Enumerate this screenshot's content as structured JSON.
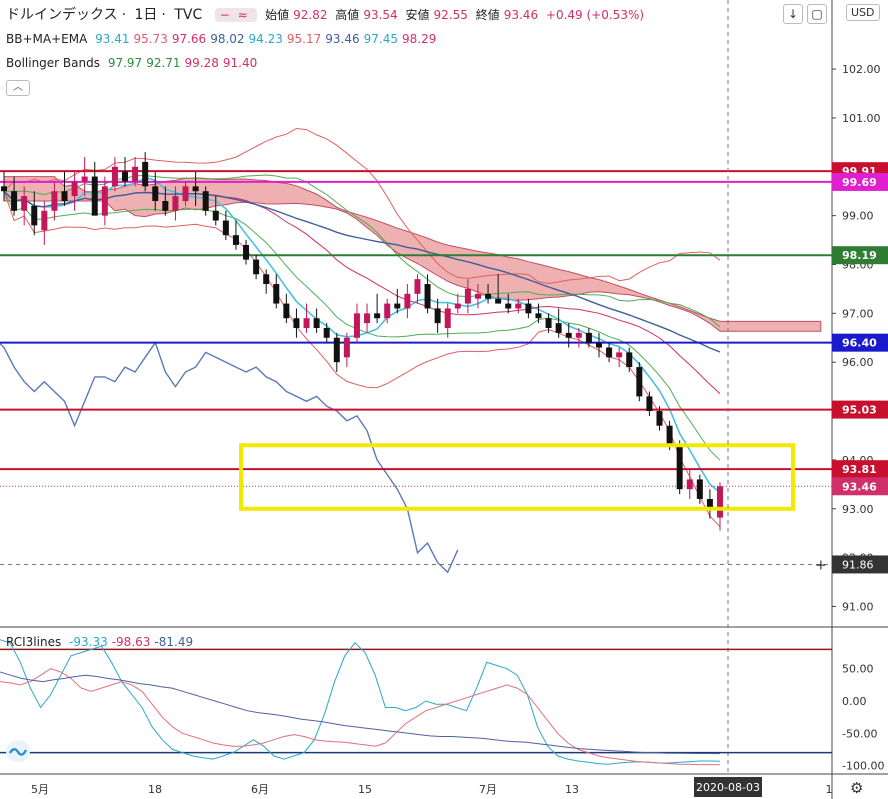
{
  "header": {
    "symbol": "ドルインデックス",
    "interval": "1日",
    "source": "TVC",
    "open_label": "始値",
    "open": "92.82",
    "high_label": "高値",
    "high": "93.54",
    "low_label": "安値",
    "low": "92.55",
    "close_label": "終値",
    "close": "93.46",
    "change": "+0.49 (+0.53%)",
    "currency": "USD",
    "sep": "·",
    "pill_minus": "−",
    "pill_wave": "≈"
  },
  "toolbar": {
    "down_icon": "↓",
    "fullscreen_icon": "▢",
    "collapse_icon": "︿",
    "settings_icon": "⚙"
  },
  "indicators": {
    "bbmaema": {
      "name": "BB+MA+EMA",
      "values": [
        {
          "v": "93.41",
          "color": "#29a8c9"
        },
        {
          "v": "95.73",
          "color": "#e05a6a"
        },
        {
          "v": "97.66",
          "color": "#d0306a"
        },
        {
          "v": "98.02",
          "color": "#3f5f9a"
        },
        {
          "v": "94.23",
          "color": "#29a8c9"
        },
        {
          "v": "95.17",
          "color": "#e05a6a"
        },
        {
          "v": "93.46",
          "color": "#3f5f9a"
        },
        {
          "v": "97.45",
          "color": "#29a8c9"
        },
        {
          "v": "98.29",
          "color": "#d0306a"
        }
      ]
    },
    "bollinger": {
      "name": "Bollinger Bands",
      "values": [
        {
          "v": "97.97",
          "color": "#2e8b3a"
        },
        {
          "v": "92.71",
          "color": "#2e8b3a"
        },
        {
          "v": "99.28",
          "color": "#d0306a"
        },
        {
          "v": "91.40",
          "color": "#d0306a"
        }
      ]
    },
    "rci": {
      "name": "RCI3lines",
      "values": [
        {
          "v": "-93.33",
          "color": "#29a8c9"
        },
        {
          "v": "-98.63",
          "color": "#d0306a"
        },
        {
          "v": "-81.49",
          "color": "#3f5f9a"
        }
      ]
    }
  },
  "chart_data": [
    {
      "type": "candlestick",
      "ylim": [
        90.6,
        102.8
      ],
      "y_ticks": [
        "91.00",
        "92.00",
        "93.00",
        "94.00",
        "95.00",
        "96.00",
        "97.00",
        "98.00",
        "99.00",
        "100.00",
        "101.00",
        "102.00"
      ],
      "x_ticks": [
        "5月",
        "18",
        "6月",
        "15",
        "7月",
        "13",
        "1"
      ],
      "crosshair_date": "2020-08-03",
      "crosshair_price": "91.86",
      "candles": [
        {
          "o": 99.6,
          "h": 99.9,
          "l": 99.3,
          "c": 99.5
        },
        {
          "o": 99.5,
          "h": 99.8,
          "l": 99.0,
          "c": 99.1
        },
        {
          "o": 99.1,
          "h": 99.6,
          "l": 98.8,
          "c": 99.4
        },
        {
          "o": 99.2,
          "h": 99.5,
          "l": 98.6,
          "c": 98.8
        },
        {
          "o": 98.7,
          "h": 99.3,
          "l": 98.4,
          "c": 99.1
        },
        {
          "o": 99.1,
          "h": 99.7,
          "l": 98.9,
          "c": 99.5
        },
        {
          "o": 99.5,
          "h": 99.9,
          "l": 99.2,
          "c": 99.3
        },
        {
          "o": 99.4,
          "h": 99.9,
          "l": 99.1,
          "c": 99.7
        },
        {
          "o": 99.7,
          "h": 100.2,
          "l": 99.4,
          "c": 99.8
        },
        {
          "o": 99.8,
          "h": 100.1,
          "l": 99.2,
          "c": 99.0
        },
        {
          "o": 99.0,
          "h": 99.8,
          "l": 98.8,
          "c": 99.6
        },
        {
          "o": 99.6,
          "h": 100.2,
          "l": 99.5,
          "c": 100.0
        },
        {
          "o": 99.9,
          "h": 100.2,
          "l": 99.6,
          "c": 99.7
        },
        {
          "o": 99.7,
          "h": 100.2,
          "l": 99.6,
          "c": 100.0
        },
        {
          "o": 100.1,
          "h": 100.3,
          "l": 99.5,
          "c": 99.6
        },
        {
          "o": 99.6,
          "h": 99.9,
          "l": 99.1,
          "c": 99.3
        },
        {
          "o": 99.3,
          "h": 99.6,
          "l": 99.0,
          "c": 99.1
        },
        {
          "o": 99.1,
          "h": 99.6,
          "l": 98.9,
          "c": 99.4
        },
        {
          "o": 99.3,
          "h": 99.7,
          "l": 99.2,
          "c": 99.6
        },
        {
          "o": 99.6,
          "h": 99.9,
          "l": 99.2,
          "c": 99.5
        },
        {
          "o": 99.5,
          "h": 99.6,
          "l": 99.0,
          "c": 99.1
        },
        {
          "o": 99.1,
          "h": 99.4,
          "l": 98.8,
          "c": 98.9
        },
        {
          "o": 98.9,
          "h": 99.1,
          "l": 98.5,
          "c": 98.6
        },
        {
          "o": 98.6,
          "h": 98.9,
          "l": 98.3,
          "c": 98.4
        },
        {
          "o": 98.4,
          "h": 98.5,
          "l": 98.0,
          "c": 98.1
        },
        {
          "o": 98.1,
          "h": 98.2,
          "l": 97.7,
          "c": 97.8
        },
        {
          "o": 97.8,
          "h": 97.9,
          "l": 97.4,
          "c": 97.6
        },
        {
          "o": 97.6,
          "h": 97.8,
          "l": 97.1,
          "c": 97.2
        },
        {
          "o": 97.2,
          "h": 97.4,
          "l": 96.8,
          "c": 96.9
        },
        {
          "o": 96.9,
          "h": 97.1,
          "l": 96.5,
          "c": 96.7
        },
        {
          "o": 96.7,
          "h": 97.2,
          "l": 96.6,
          "c": 96.9
        },
        {
          "o": 96.9,
          "h": 97.1,
          "l": 96.6,
          "c": 96.7
        },
        {
          "o": 96.7,
          "h": 96.8,
          "l": 96.4,
          "c": 96.5
        },
        {
          "o": 96.5,
          "h": 96.6,
          "l": 95.8,
          "c": 96.0
        },
        {
          "o": 96.1,
          "h": 96.6,
          "l": 95.9,
          "c": 96.5
        },
        {
          "o": 96.5,
          "h": 97.2,
          "l": 96.4,
          "c": 97.0
        },
        {
          "o": 96.8,
          "h": 97.2,
          "l": 96.6,
          "c": 97.0
        },
        {
          "o": 97.0,
          "h": 97.4,
          "l": 96.8,
          "c": 96.9
        },
        {
          "o": 96.9,
          "h": 97.3,
          "l": 96.8,
          "c": 97.2
        },
        {
          "o": 97.2,
          "h": 97.5,
          "l": 97.0,
          "c": 97.1
        },
        {
          "o": 97.1,
          "h": 97.6,
          "l": 96.9,
          "c": 97.4
        },
        {
          "o": 97.4,
          "h": 97.8,
          "l": 97.2,
          "c": 97.7
        },
        {
          "o": 97.6,
          "h": 97.8,
          "l": 97.0,
          "c": 97.1
        },
        {
          "o": 97.1,
          "h": 97.3,
          "l": 96.6,
          "c": 96.8
        },
        {
          "o": 96.7,
          "h": 97.2,
          "l": 96.5,
          "c": 97.1
        },
        {
          "o": 97.1,
          "h": 97.4,
          "l": 97.0,
          "c": 97.2
        },
        {
          "o": 97.2,
          "h": 97.7,
          "l": 97.0,
          "c": 97.5
        },
        {
          "o": 97.3,
          "h": 97.6,
          "l": 97.1,
          "c": 97.4
        },
        {
          "o": 97.4,
          "h": 97.6,
          "l": 97.2,
          "c": 97.3
        },
        {
          "o": 97.3,
          "h": 97.8,
          "l": 97.2,
          "c": 97.2
        },
        {
          "o": 97.2,
          "h": 97.4,
          "l": 97.0,
          "c": 97.1
        },
        {
          "o": 97.1,
          "h": 97.3,
          "l": 97.0,
          "c": 97.2
        },
        {
          "o": 97.2,
          "h": 97.3,
          "l": 96.9,
          "c": 97.0
        },
        {
          "o": 97.0,
          "h": 97.2,
          "l": 96.8,
          "c": 96.9
        },
        {
          "o": 96.9,
          "h": 97.0,
          "l": 96.6,
          "c": 96.7
        },
        {
          "o": 96.8,
          "h": 97.1,
          "l": 96.5,
          "c": 96.6
        },
        {
          "o": 96.6,
          "h": 96.8,
          "l": 96.3,
          "c": 96.5
        },
        {
          "o": 96.5,
          "h": 96.7,
          "l": 96.3,
          "c": 96.6
        },
        {
          "o": 96.6,
          "h": 96.7,
          "l": 96.3,
          "c": 96.4
        },
        {
          "o": 96.4,
          "h": 96.6,
          "l": 96.1,
          "c": 96.3
        },
        {
          "o": 96.3,
          "h": 96.4,
          "l": 96.0,
          "c": 96.1
        },
        {
          "o": 96.1,
          "h": 96.3,
          "l": 95.9,
          "c": 96.2
        },
        {
          "o": 96.2,
          "h": 96.3,
          "l": 95.8,
          "c": 95.9
        },
        {
          "o": 95.9,
          "h": 96.0,
          "l": 95.2,
          "c": 95.3
        },
        {
          "o": 95.3,
          "h": 95.4,
          "l": 94.9,
          "c": 95.0
        },
        {
          "o": 95.0,
          "h": 95.1,
          "l": 94.6,
          "c": 94.7
        },
        {
          "o": 94.7,
          "h": 94.8,
          "l": 94.2,
          "c": 94.3
        },
        {
          "o": 94.3,
          "h": 94.4,
          "l": 93.3,
          "c": 93.4
        },
        {
          "o": 93.4,
          "h": 93.8,
          "l": 93.2,
          "c": 93.6
        },
        {
          "o": 93.6,
          "h": 93.7,
          "l": 93.1,
          "c": 93.2
        },
        {
          "o": 93.2,
          "h": 93.4,
          "l": 92.8,
          "c": 93.0
        },
        {
          "o": 92.82,
          "h": 93.54,
          "l": 92.55,
          "c": 93.46
        }
      ],
      "horizontal_levels": [
        {
          "price": 99.91,
          "label": "99.91",
          "color": "#c8102e"
        },
        {
          "price": 99.69,
          "label": "99.69",
          "color": "#e020d0"
        },
        {
          "price": 98.19,
          "label": "98.19",
          "color": "#2e7d32"
        },
        {
          "price": 96.4,
          "label": "96.40",
          "color": "#1a1acc"
        },
        {
          "price": 95.03,
          "label": "95.03",
          "color": "#c8102e"
        },
        {
          "price": 93.81,
          "label": "93.81",
          "color": "#c8102e"
        },
        {
          "price": 93.46,
          "label": "93.46",
          "color": "#d0306a"
        }
      ],
      "highlight_box": {
        "color": "#f5e800",
        "price_top": 94.3,
        "price_bottom": 93.0
      }
    },
    {
      "type": "line",
      "ylim": [
        -110,
        110
      ],
      "y_ticks": [
        "50.00",
        "0.00",
        "-50.00",
        "-100.00"
      ],
      "levels": [
        80,
        -80
      ],
      "series": [
        {
          "color": "#29a8c9",
          "values": [
            95,
            90,
            60,
            20,
            -10,
            10,
            40,
            70,
            75,
            80,
            85,
            60,
            30,
            10,
            -10,
            -40,
            -60,
            -75,
            -80,
            -85,
            -88,
            -90,
            -85,
            -80,
            -70,
            -60,
            -70,
            -85,
            -90,
            -85,
            -80,
            -60,
            -20,
            30,
            70,
            90,
            75,
            40,
            -10,
            -10,
            -15,
            -10,
            0,
            -5,
            -5,
            -10,
            -15,
            20,
            60,
            55,
            50,
            40,
            10,
            -40,
            -70,
            -85,
            -90,
            -93,
            -95,
            -97,
            -98,
            -96,
            -95,
            -94,
            -95,
            -96,
            -96,
            -95,
            -94,
            -93,
            -93,
            -93.33
          ]
        },
        {
          "color": "#e07080",
          "values": [
            30,
            28,
            25,
            30,
            40,
            50,
            45,
            35,
            20,
            15,
            20,
            25,
            30,
            25,
            15,
            -5,
            -25,
            -40,
            -50,
            -55,
            -60,
            -65,
            -68,
            -70,
            -70,
            -68,
            -65,
            -60,
            -55,
            -52,
            -55,
            -60,
            -62,
            -63,
            -64,
            -66,
            -68,
            -70,
            -65,
            -50,
            -35,
            -25,
            -15,
            -10,
            -5,
            0,
            5,
            10,
            15,
            20,
            25,
            20,
            10,
            -10,
            -30,
            -50,
            -65,
            -75,
            -80,
            -85,
            -88,
            -90,
            -92,
            -94,
            -95,
            -96,
            -97,
            -98,
            -98,
            -98.5,
            -98.6,
            -98.63
          ]
        },
        {
          "color": "#5060a0",
          "values": [
            45,
            40,
            35,
            32,
            30,
            33,
            35,
            38,
            40,
            38,
            35,
            33,
            30,
            27,
            25,
            22,
            20,
            15,
            10,
            5,
            0,
            -5,
            -10,
            -15,
            -18,
            -20,
            -22,
            -25,
            -28,
            -30,
            -32,
            -35,
            -38,
            -40,
            -42,
            -44,
            -46,
            -48,
            -50,
            -52,
            -54,
            -55,
            -55,
            -56,
            -57,
            -58,
            -60,
            -62,
            -63,
            -64,
            -66,
            -68,
            -70,
            -72,
            -74,
            -75,
            -76,
            -77,
            -78,
            -79,
            -80,
            -80,
            -81,
            -81,
            -81.2,
            -81.3,
            -81.4,
            -81.49
          ]
        }
      ]
    }
  ]
}
